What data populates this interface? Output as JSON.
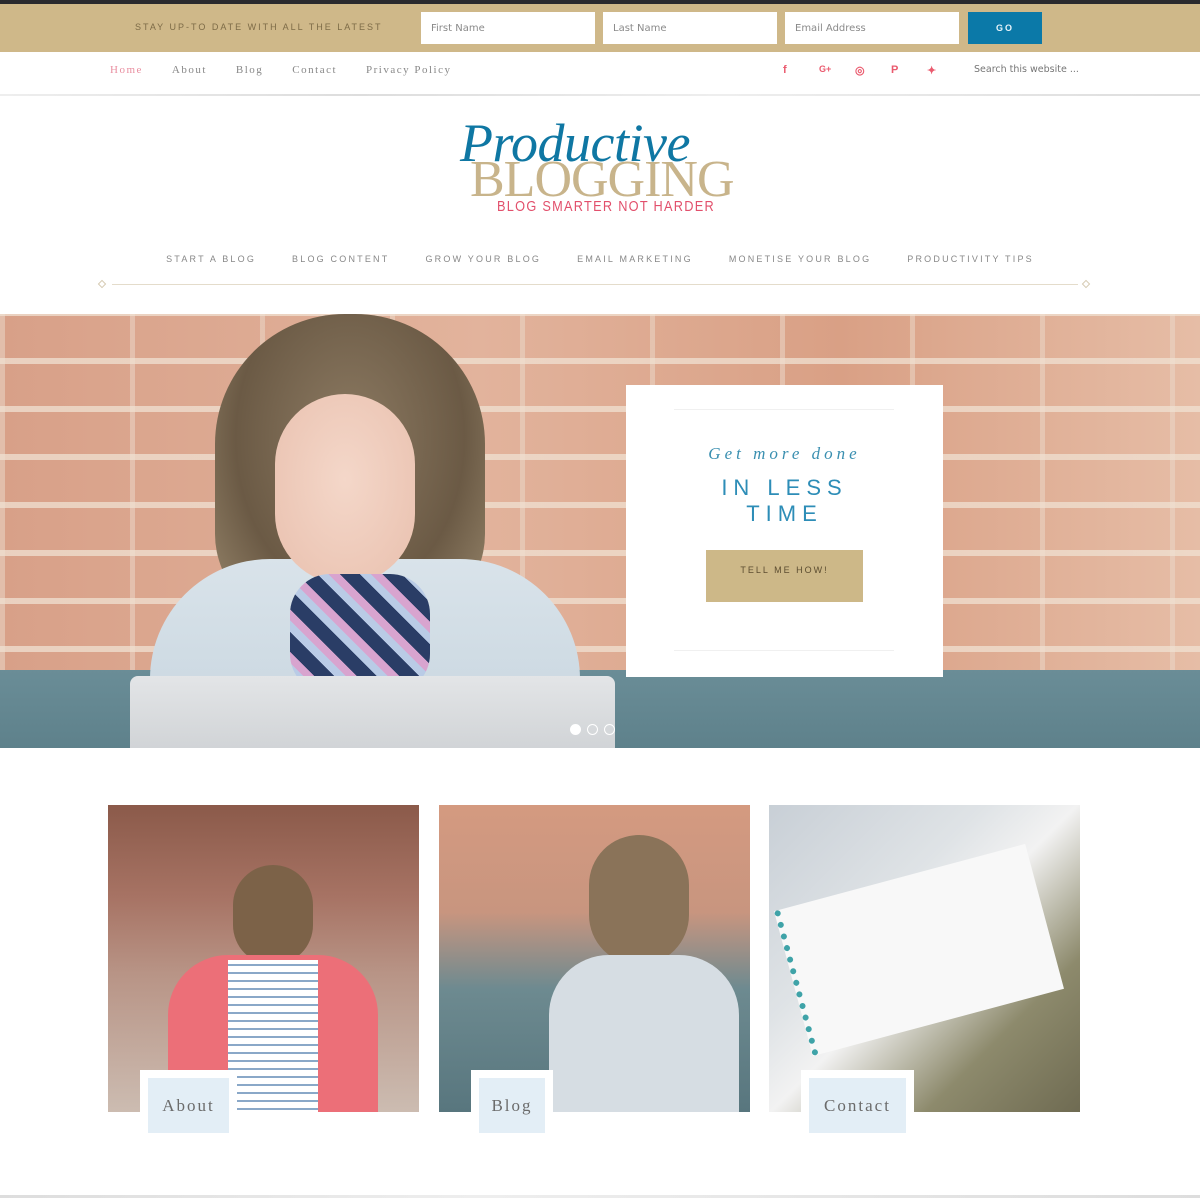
{
  "optin": {
    "tagline": "STAY UP-TO DATE WITH ALL THE LATEST",
    "first_name_placeholder": "First Name",
    "last_name_placeholder": "Last Name",
    "email_placeholder": "Email Address",
    "go_label": "GO"
  },
  "secondary_nav": {
    "links": [
      "Home",
      "About",
      "Blog",
      "Contact",
      "Privacy Policy"
    ],
    "active": "Home",
    "social": [
      {
        "icon": "facebook-icon",
        "glyph": "f"
      },
      {
        "icon": "google-plus-icon",
        "glyph": "G+"
      },
      {
        "icon": "instagram-icon",
        "glyph": "◎"
      },
      {
        "icon": "pinterest-icon",
        "glyph": "P"
      },
      {
        "icon": "twitter-icon",
        "glyph": "✦"
      }
    ],
    "search_placeholder": "Search this website ..."
  },
  "logo": {
    "line1": "Productive",
    "line2": "BLOGGING",
    "tagline": "BLOG SMARTER NOT HARDER"
  },
  "main_nav": [
    "START A BLOG",
    "BLOG CONTENT",
    "GROW YOUR BLOG",
    "EMAIL MARKETING",
    "MONETISE YOUR BLOG",
    "PRODUCTIVITY TIPS"
  ],
  "hero": {
    "script_text": "Get more done",
    "headline_line1": "IN LESS",
    "headline_line2": "TIME",
    "button_label": "TELL ME HOW!",
    "slides_total": 3,
    "active_slide": 1
  },
  "features": [
    {
      "label": "About"
    },
    {
      "label": "Blog"
    },
    {
      "label": "Contact"
    }
  ],
  "colors": {
    "gold": "#cfb889",
    "blue": "#0b79a8",
    "pink": "#ea5a6e"
  }
}
